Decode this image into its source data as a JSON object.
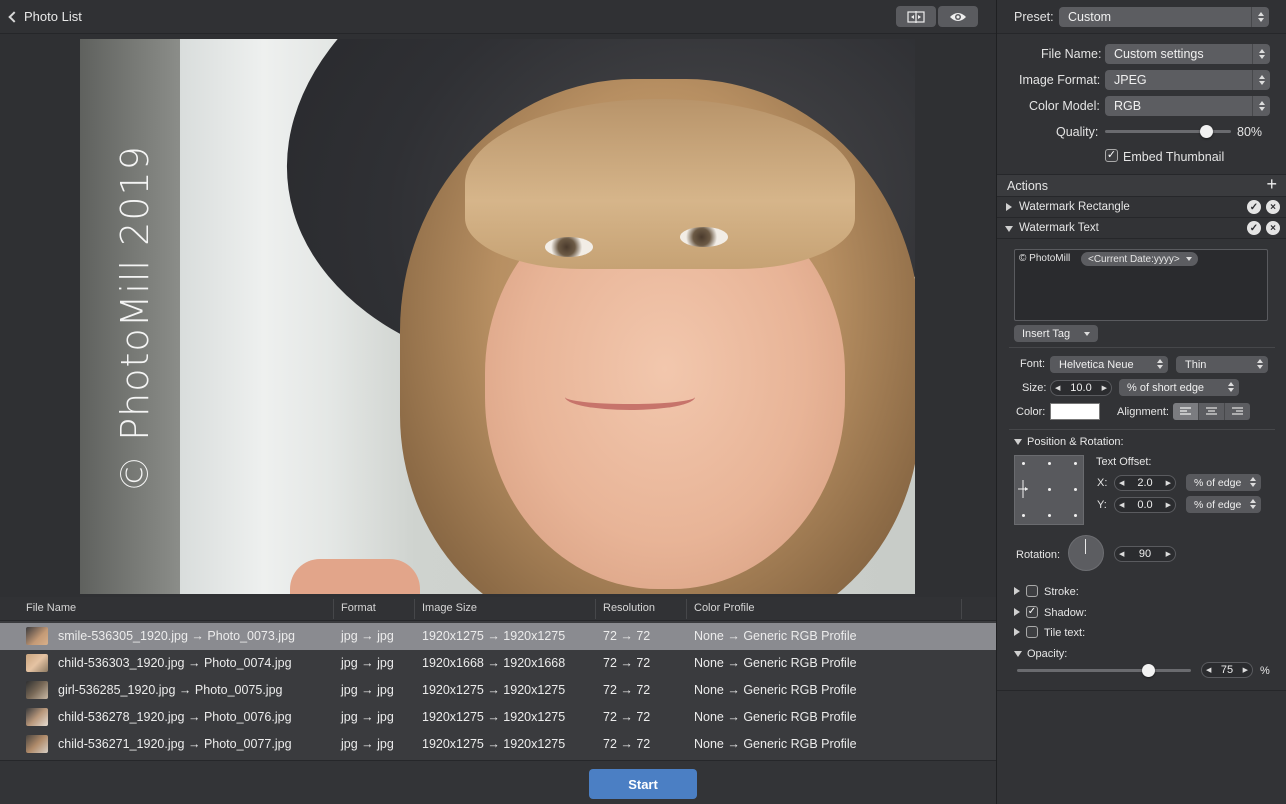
{
  "toolbar": {
    "back_label": "Photo List"
  },
  "photo": {
    "watermark_text": "© PhotoMill 2019"
  },
  "table": {
    "headers": [
      "File Name",
      "Format",
      "Image Size",
      "Resolution",
      "Color Profile"
    ],
    "rows": [
      {
        "name": "smile-536305_1920.jpg → Photo_0073.jpg",
        "format": "jpg → jpg",
        "size": "1920x1275 → 1920x1275",
        "res": "72 → 72",
        "profile": "None → Generic RGB Profile"
      },
      {
        "name": "child-536303_1920.jpg → Photo_0074.jpg",
        "format": "jpg → jpg",
        "size": "1920x1668 → 1920x1668",
        "res": "72 → 72",
        "profile": "None → Generic RGB Profile"
      },
      {
        "name": "girl-536285_1920.jpg → Photo_0075.jpg",
        "format": "jpg → jpg",
        "size": "1920x1275 → 1920x1275",
        "res": "72 → 72",
        "profile": "None → Generic RGB Profile"
      },
      {
        "name": "child-536278_1920.jpg → Photo_0076.jpg",
        "format": "jpg → jpg",
        "size": "1920x1275 → 1920x1275",
        "res": "72 → 72",
        "profile": "None → Generic RGB Profile"
      },
      {
        "name": "child-536271_1920.jpg → Photo_0077.jpg",
        "format": "jpg → jpg",
        "size": "1920x1275 → 1920x1275",
        "res": "72 → 72",
        "profile": "None → Generic RGB Profile"
      }
    ]
  },
  "start_label": "Start",
  "panel": {
    "preset_label": "Preset:",
    "preset_value": "Custom",
    "file_name_label": "File Name:",
    "file_name_value": "Custom settings",
    "image_format_label": "Image Format:",
    "image_format_value": "JPEG",
    "color_model_label": "Color Model:",
    "color_model_value": "RGB",
    "quality_label": "Quality:",
    "quality_value": "80%",
    "quality_level": 0.8,
    "embed_thumbnail_label": "Embed Thumbnail",
    "embed_thumbnail_checked": true,
    "actions_label": "Actions",
    "actions": [
      {
        "label": "Watermark Rectangle",
        "expanded": false
      },
      {
        "label": "Watermark Text",
        "expanded": true
      }
    ],
    "text_tokens": {
      "static": "© PhotoMill",
      "tag": "<Current Date:yyyy>"
    },
    "insert_tag_label": "Insert Tag",
    "font_label": "Font:",
    "font_value": "Helvetica Neue",
    "font_weight": "Thin",
    "size_label": "Size:",
    "size_value": "10.0",
    "size_unit": "% of short edge",
    "color_label": "Color:",
    "color_value": "#ffffff",
    "alignment_label": "Alignment:",
    "position_label": "Position & Rotation:",
    "text_offset_label": "Text Offset:",
    "x_label": "X:",
    "x_value": "2.0",
    "x_unit": "% of edge",
    "y_label": "Y:",
    "y_value": "0.0",
    "y_unit": "% of edge",
    "rotation_label": "Rotation:",
    "rotation_value": "90",
    "stroke_label": "Stroke:",
    "shadow_label": "Shadow:",
    "tile_label": "Tile text:",
    "opacity_label": "Opacity:",
    "opacity_value": "75",
    "opacity_unit": "%",
    "opacity_level": 0.75
  },
  "colors": {
    "accent": "#4b7fc4",
    "selected_row": "#8a8b90"
  }
}
